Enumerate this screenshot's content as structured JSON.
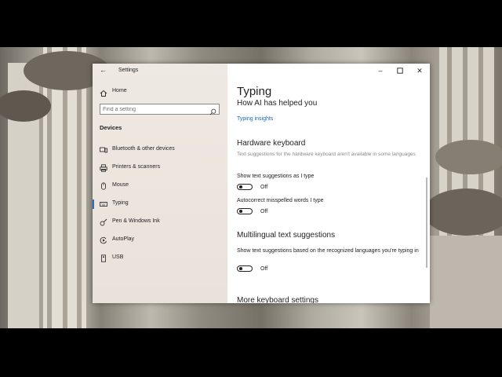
{
  "window": {
    "title": "Settings"
  },
  "search": {
    "placeholder": "Find a setting"
  },
  "sidebar": {
    "home_label": "Home",
    "section": "Devices",
    "items": [
      {
        "label": "Bluetooth & other devices",
        "icon": "bluetooth-icon",
        "selected": false
      },
      {
        "label": "Printers & scanners",
        "icon": "printer-icon",
        "selected": false
      },
      {
        "label": "Mouse",
        "icon": "mouse-icon",
        "selected": false
      },
      {
        "label": "Typing",
        "icon": "keyboard-icon",
        "selected": true
      },
      {
        "label": "Pen & Windows Ink",
        "icon": "pen-icon",
        "selected": false
      },
      {
        "label": "AutoPlay",
        "icon": "autoplay-icon",
        "selected": false
      },
      {
        "label": "USB",
        "icon": "usb-icon",
        "selected": false
      }
    ]
  },
  "content": {
    "title": "Typing",
    "subtitle": "How AI has helped you",
    "insights_link": "Typing insights",
    "hardware": {
      "heading": "Hardware keyboard",
      "note": "Text suggestions for the hardware keyboard aren't available in some languages",
      "show_suggestions": {
        "label": "Show text suggestions as I type",
        "state": "Off"
      },
      "autocorrect": {
        "label": "Autocorrect misspelled words I type",
        "state": "Off"
      }
    },
    "multilingual": {
      "heading": "Multilingual text suggestions",
      "label": "Show text suggestions based on the recognized languages you're typing in",
      "state": "Off"
    },
    "more_heading": "More keyboard settings"
  },
  "colors": {
    "accent": "#2d6fc0",
    "link": "#1a66b8"
  }
}
